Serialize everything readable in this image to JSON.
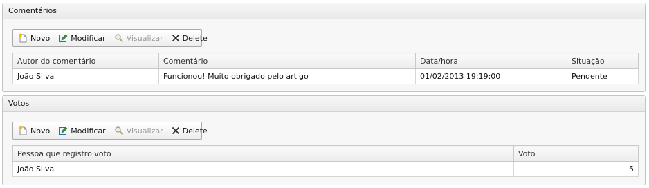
{
  "comments": {
    "title": "Comentários",
    "toolbar": {
      "new_label": "Novo",
      "edit_label": "Modificar",
      "view_label": "Visualizar",
      "delete_label": "Delete"
    },
    "columns": [
      "Autor do comentário",
      "Comentário",
      "Data/hora",
      "Situação"
    ],
    "rows": [
      [
        "João Silva",
        "Funcionou! Muito obrigado pelo artigo",
        "01/02/2013 19:19:00",
        "Pendente"
      ]
    ]
  },
  "votes": {
    "title": "Votos",
    "toolbar": {
      "new_label": "Novo",
      "edit_label": "Modificar",
      "view_label": "Visualizar",
      "delete_label": "Delete"
    },
    "columns": [
      "Pessoa que registro voto",
      "Voto"
    ],
    "rows": [
      [
        "João Silva",
        "5"
      ]
    ]
  },
  "colors": {
    "disabled_text": "#9a9a9a",
    "border": "#c4c4c4"
  }
}
